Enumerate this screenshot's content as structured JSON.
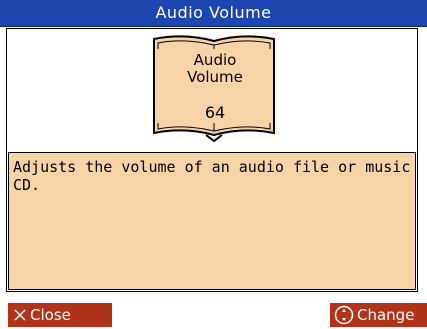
{
  "title": "Audio Volume",
  "card": {
    "title_line1": "Audio",
    "title_line2": "Volume",
    "value": "64"
  },
  "description": "Adjusts the volume of an audio file or music CD.",
  "buttons": {
    "close_label": "Close",
    "change_label": "Change"
  },
  "icons": {
    "close": "close-x-icon",
    "change": "dial-icon"
  },
  "colors": {
    "title_bar": "#1d46b0",
    "card_fill": "#f7d3a8",
    "button_fill": "#b13319"
  }
}
